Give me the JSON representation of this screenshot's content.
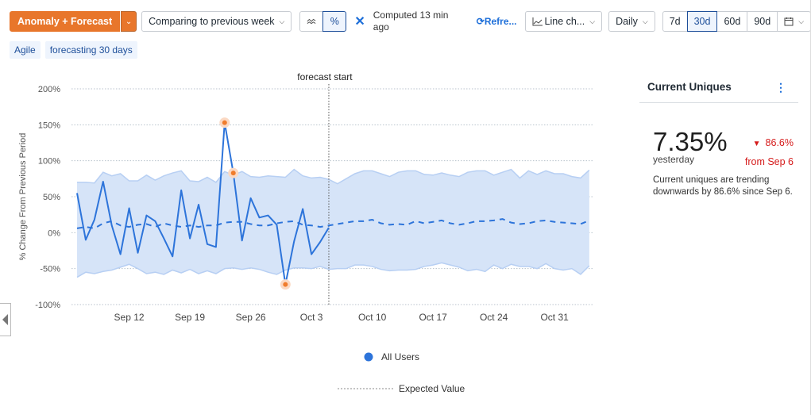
{
  "toolbar": {
    "mode_label": "Anomaly + Forecast",
    "compare_label": "Comparing to previous week",
    "toggle_line_icon": "trend-lines-icon",
    "toggle_percent_label": "%",
    "computed_text": "Computed 13 min ago",
    "refresh_label": "Refre...",
    "chart_type_label": "Line ch...",
    "interval_label": "Daily",
    "ranges": [
      "7d",
      "30d",
      "60d",
      "90d"
    ],
    "active_range": "30d",
    "calendar_icon": "calendar-icon"
  },
  "tags": [
    "Agile",
    "forecasting 30 days"
  ],
  "panel": {
    "title": "Current Uniques",
    "value": "7.35%",
    "value_caption": "yesterday",
    "delta": "86.6%",
    "delta_caption": "from Sep 6",
    "description": "Current uniques are trending downwards by 86.6% since Sep 6.",
    "delta_color": "#d51b1b"
  },
  "colors": {
    "accent": "#e8762b",
    "line": "#2d74da",
    "band": "#d6e4f8",
    "anomaly": "#f07c2c"
  },
  "chart_data": {
    "type": "line",
    "title": "",
    "ylabel": "% Change From Previous Period",
    "xlabel": "",
    "ylim": [
      -100,
      200
    ],
    "yticks": [
      200,
      150,
      100,
      50,
      0,
      -50,
      -100
    ],
    "ytick_labels": [
      "200%",
      "150%",
      "100%",
      "50%",
      "0%",
      "-50%",
      "-100%"
    ],
    "xtick_labels": [
      "Sep 12",
      "Sep 19",
      "Sep 26",
      "Oct 3",
      "Oct 10",
      "Oct 17",
      "Oct 24",
      "Oct 31"
    ],
    "xtick_day_index": [
      6,
      13,
      20,
      27,
      34,
      41,
      48,
      55
    ],
    "start_date": "Sep 6",
    "forecast_start_index": 29,
    "forecast_label": "forecast start",
    "grid": true,
    "legend_position": "bottom",
    "series": [
      {
        "name": "All Users",
        "style": "solid",
        "values": [
          55,
          -10,
          18,
          71,
          10,
          -30,
          34,
          -28,
          24,
          16,
          -8,
          -33,
          59,
          -8,
          39,
          -16,
          -20,
          153,
          83,
          -11,
          48,
          21,
          24,
          11,
          -72,
          -12,
          33,
          -30,
          -13,
          7
        ]
      },
      {
        "name": "Expected Value",
        "style": "dashed",
        "values": [
          6,
          8,
          6,
          13,
          16,
          10,
          8,
          11,
          12,
          8,
          13,
          10,
          8,
          10,
          8,
          10,
          10,
          14,
          15,
          15,
          12,
          10,
          10,
          13,
          15,
          16,
          11,
          10,
          8,
          10,
          12,
          14,
          16,
          16,
          18,
          13,
          11,
          12,
          11,
          16,
          13,
          15,
          17,
          13,
          11,
          13,
          16,
          16,
          17,
          19,
          14,
          12,
          13,
          16,
          17,
          15,
          14,
          13,
          12,
          17
        ]
      }
    ],
    "band_upper": [
      70,
      70,
      69,
      84,
      79,
      82,
      72,
      72,
      80,
      73,
      79,
      83,
      86,
      72,
      71,
      77,
      70,
      85,
      80,
      85,
      78,
      77,
      79,
      78,
      77,
      88,
      79,
      76,
      77,
      74,
      68,
      75,
      82,
      86,
      86,
      82,
      78,
      84,
      86,
      86,
      81,
      80,
      83,
      80,
      78,
      84,
      86,
      86,
      80,
      84,
      88,
      76,
      86,
      81,
      86,
      82,
      82,
      78,
      76,
      87
    ],
    "band_lower": [
      -62,
      -55,
      -57,
      -54,
      -52,
      -48,
      -44,
      -50,
      -57,
      -55,
      -58,
      -52,
      -56,
      -51,
      -57,
      -53,
      -57,
      -50,
      -49,
      -51,
      -49,
      -51,
      -55,
      -58,
      -52,
      -49,
      -49,
      -50,
      -47,
      -51,
      -50,
      -50,
      -45,
      -45,
      -47,
      -51,
      -53,
      -52,
      -52,
      -51,
      -47,
      -45,
      -42,
      -45,
      -48,
      -53,
      -51,
      -54,
      -45,
      -50,
      -44,
      -47,
      -47,
      -50,
      -43,
      -50,
      -52,
      -50,
      -58,
      -46
    ],
    "anomalies": [
      {
        "index": 17,
        "value": 153
      },
      {
        "index": 18,
        "value": 83
      },
      {
        "index": 24,
        "value": -72
      }
    ],
    "legend": [
      {
        "label": "All Users",
        "marker": "dot"
      },
      {
        "label": "Expected Value",
        "marker": "dashed-line"
      }
    ]
  }
}
